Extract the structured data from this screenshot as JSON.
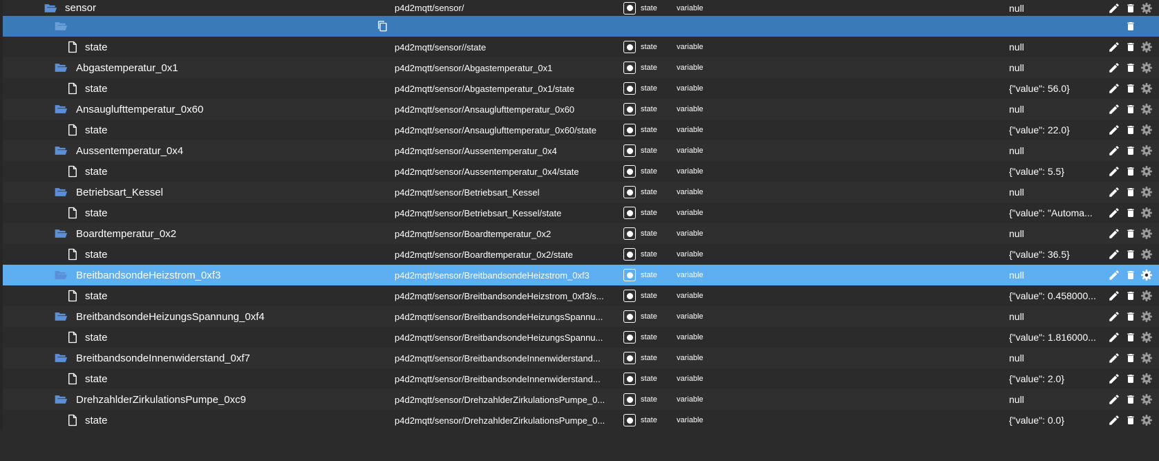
{
  "colors": {
    "background": "#2b2b2b",
    "selected_dark": "#3a7ab8",
    "selected_light": "#5eaef2",
    "folder_icon": "#5b8fd6",
    "text": "#ffffff",
    "icon_gray": "#9a9a9a"
  },
  "icons": {
    "folder": "folder-open-icon",
    "file": "file-icon",
    "copy": "copy-icon",
    "edit": "pencil-icon",
    "delete": "trash-icon",
    "settings": "gear-icon"
  },
  "rows": [
    {
      "kind": "folder",
      "level": 0,
      "name": "sensor",
      "path": "p4d2mqtt/sensor/",
      "role": "state",
      "type": "variable",
      "value": "null",
      "actions": [
        "edit",
        "delete",
        "gear"
      ]
    },
    {
      "kind": "folder",
      "level": 1,
      "name": "",
      "path": "",
      "role": "",
      "type": "",
      "value": "",
      "selected": "dark",
      "copy": true,
      "actions": [
        "delete"
      ]
    },
    {
      "kind": "file",
      "level": 2,
      "name": "state",
      "path": "p4d2mqtt/sensor//state",
      "role": "state",
      "type": "variable",
      "value": "null",
      "actions": [
        "edit",
        "delete",
        "gear"
      ]
    },
    {
      "kind": "folder",
      "level": 1,
      "name": "Abgastemperatur_0x1",
      "path": "p4d2mqtt/sensor/Abgastemperatur_0x1",
      "role": "state",
      "type": "variable",
      "value": "null",
      "actions": [
        "edit",
        "delete",
        "gear"
      ]
    },
    {
      "kind": "file",
      "level": 2,
      "name": "state",
      "path": "p4d2mqtt/sensor/Abgastemperatur_0x1/state",
      "role": "state",
      "type": "variable",
      "value": "{\"value\": 56.0}",
      "actions": [
        "edit",
        "delete",
        "gear"
      ]
    },
    {
      "kind": "folder",
      "level": 1,
      "name": "Ansauglufttemperatur_0x60",
      "path": "p4d2mqtt/sensor/Ansauglufttemperatur_0x60",
      "role": "state",
      "type": "variable",
      "value": "null",
      "actions": [
        "edit",
        "delete",
        "gear"
      ]
    },
    {
      "kind": "file",
      "level": 2,
      "name": "state",
      "path": "p4d2mqtt/sensor/Ansauglufttemperatur_0x60/state",
      "role": "state",
      "type": "variable",
      "value": "{\"value\": 22.0}",
      "actions": [
        "edit",
        "delete",
        "gear"
      ]
    },
    {
      "kind": "folder",
      "level": 1,
      "name": "Aussentemperatur_0x4",
      "path": "p4d2mqtt/sensor/Aussentemperatur_0x4",
      "role": "state",
      "type": "variable",
      "value": "null",
      "actions": [
        "edit",
        "delete",
        "gear"
      ]
    },
    {
      "kind": "file",
      "level": 2,
      "name": "state",
      "path": "p4d2mqtt/sensor/Aussentemperatur_0x4/state",
      "role": "state",
      "type": "variable",
      "value": "{\"value\": 5.5}",
      "actions": [
        "edit",
        "delete",
        "gear"
      ]
    },
    {
      "kind": "folder",
      "level": 1,
      "name": "Betriebsart_Kessel",
      "path": "p4d2mqtt/sensor/Betriebsart_Kessel",
      "role": "state",
      "type": "variable",
      "value": "null",
      "actions": [
        "edit",
        "delete",
        "gear"
      ]
    },
    {
      "kind": "file",
      "level": 2,
      "name": "state",
      "path": "p4d2mqtt/sensor/Betriebsart_Kessel/state",
      "role": "state",
      "type": "variable",
      "value": "{\"value\": \"Automa...",
      "actions": [
        "edit",
        "delete",
        "gear"
      ]
    },
    {
      "kind": "folder",
      "level": 1,
      "name": "Boardtemperatur_0x2",
      "path": "p4d2mqtt/sensor/Boardtemperatur_0x2",
      "role": "state",
      "type": "variable",
      "value": "null",
      "actions": [
        "edit",
        "delete",
        "gear"
      ]
    },
    {
      "kind": "file",
      "level": 2,
      "name": "state",
      "path": "p4d2mqtt/sensor/Boardtemperatur_0x2/state",
      "role": "state",
      "type": "variable",
      "value": "{\"value\": 36.5}",
      "actions": [
        "edit",
        "delete",
        "gear"
      ]
    },
    {
      "kind": "folder",
      "level": 1,
      "name": "BreitbandsondeHeizstrom_0xf3",
      "path": "p4d2mqtt/sensor/BreitbandsondeHeizstrom_0xf3",
      "role": "state",
      "type": "variable",
      "value": "null",
      "selected": "light",
      "actions": [
        "edit",
        "delete",
        "gear"
      ]
    },
    {
      "kind": "file",
      "level": 2,
      "name": "state",
      "path": "p4d2mqtt/sensor/BreitbandsondeHeizstrom_0xf3/s...",
      "role": "state",
      "type": "variable",
      "value": "{\"value\": 0.458000...",
      "actions": [
        "edit",
        "delete",
        "gear"
      ]
    },
    {
      "kind": "folder",
      "level": 1,
      "name": "BreitbandsondeHeizungsSpannung_0xf4",
      "path": "p4d2mqtt/sensor/BreitbandsondeHeizungsSpannu...",
      "role": "state",
      "type": "variable",
      "value": "null",
      "actions": [
        "edit",
        "delete",
        "gear"
      ]
    },
    {
      "kind": "file",
      "level": 2,
      "name": "state",
      "path": "p4d2mqtt/sensor/BreitbandsondeHeizungsSpannu...",
      "role": "state",
      "type": "variable",
      "value": "{\"value\": 1.816000...",
      "actions": [
        "edit",
        "delete",
        "gear"
      ]
    },
    {
      "kind": "folder",
      "level": 1,
      "name": "BreitbandsondeInnenwiderstand_0xf7",
      "path": "p4d2mqtt/sensor/BreitbandsondeInnenwiderstand...",
      "role": "state",
      "type": "variable",
      "value": "null",
      "actions": [
        "edit",
        "delete",
        "gear"
      ]
    },
    {
      "kind": "file",
      "level": 2,
      "name": "state",
      "path": "p4d2mqtt/sensor/BreitbandsondeInnenwiderstand...",
      "role": "state",
      "type": "variable",
      "value": "{\"value\": 2.0}",
      "actions": [
        "edit",
        "delete",
        "gear"
      ]
    },
    {
      "kind": "folder",
      "level": 1,
      "name": "DrehzahlderZirkulationsPumpe_0xc9",
      "path": "p4d2mqtt/sensor/DrehzahlderZirkulationsPumpe_0...",
      "role": "state",
      "type": "variable",
      "value": "null",
      "actions": [
        "edit",
        "delete",
        "gear"
      ]
    },
    {
      "kind": "file",
      "level": 2,
      "name": "state",
      "path": "p4d2mqtt/sensor/DrehzahlderZirkulationsPumpe_0...",
      "role": "state",
      "type": "variable",
      "value": "{\"value\": 0.0}",
      "actions": [
        "edit",
        "delete",
        "gear"
      ]
    }
  ]
}
